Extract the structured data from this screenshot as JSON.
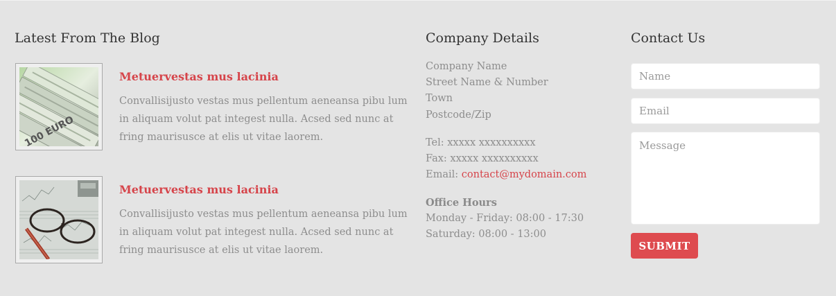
{
  "blog": {
    "title": "Latest From The Blog",
    "posts": [
      {
        "title": "Metuervestas mus lacinia",
        "text": "Convallisijusto vestas mus pellentum aeneansa pibu lum in aliquam volut pat integest nulla. Acsed sed nunc at fring maurisusce at elis ut vitae laorem.",
        "image": "euro-banknotes"
      },
      {
        "title": "Metuervestas mus lacinia",
        "text": "Convallisijusto vestas mus pellentum aeneansa pibu lum in aliquam volut pat integest nulla. Acsed sed nunc at fring maurisusce at elis ut vitae laorem.",
        "image": "glasses-pen-financial-charts"
      }
    ]
  },
  "company": {
    "title": "Company Details",
    "address": [
      "Company Name",
      "Street Name & Number",
      "Town",
      "Postcode/Zip"
    ],
    "tel": "Tel: xxxxx xxxxxxxxxx",
    "fax": "Fax: xxxxx xxxxxxxxxx",
    "email_label": "Email:",
    "email": "contact@mydomain.com",
    "hours_title": "Office Hours",
    "hours": [
      "Monday - Friday: 08:00 - 17:30",
      "Saturday: 08:00 - 13:00"
    ]
  },
  "contact": {
    "title": "Contact Us",
    "name_placeholder": "Name",
    "email_placeholder": "Email",
    "message_placeholder": "Message",
    "submit_label": "SUBMIT"
  },
  "colors": {
    "background": "#e4e4e4",
    "accent": "#de4b4f",
    "heading": "#333333",
    "text": "#8d8d8d"
  }
}
